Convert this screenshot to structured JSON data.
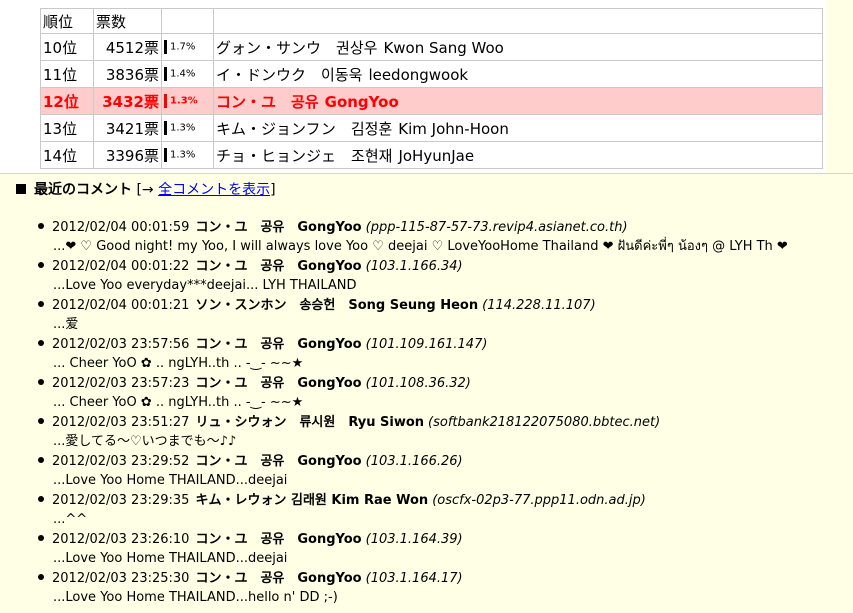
{
  "ranking": {
    "header": {
      "rank": "順位",
      "votes": "票数"
    },
    "rows": [
      {
        "rank": "10位",
        "votes": "4512票",
        "pct": "1.7%",
        "name_kana": "グォン・サンウ",
        "name_kr": "권상우",
        "name_en": "Kwon Sang Woo",
        "highlight": false
      },
      {
        "rank": "11位",
        "votes": "3836票",
        "pct": "1.4%",
        "name_kana": "イ・ドンウク",
        "name_kr": "이동욱",
        "name_en": "leedongwook",
        "highlight": false
      },
      {
        "rank": "12位",
        "votes": "3432票",
        "pct": "1.3%",
        "name_kana": "コン・ユ",
        "name_kr": "공유",
        "name_en": "GongYoo",
        "highlight": true
      },
      {
        "rank": "13位",
        "votes": "3421票",
        "pct": "1.3%",
        "name_kana": "キム・ジョンフン",
        "name_kr": "김정훈",
        "name_en": "Kim John-Hoon",
        "highlight": false
      },
      {
        "rank": "14位",
        "votes": "3396票",
        "pct": "1.3%",
        "name_kana": "チョ・ヒョンジェ",
        "name_kr": "조현재",
        "name_en": "JoHyunJae",
        "highlight": false
      }
    ]
  },
  "comments": {
    "title": "最近のコメント",
    "link_prefix": "[→",
    "link_label": "全コメントを表示",
    "link_suffix": "]",
    "items": [
      {
        "datetime": "2012/02/04 00:01:59",
        "who": "コン・ユ　공유　GongYoo",
        "host": "(ppp-115-87-57-73.revip4.asianet.co.th)",
        "text": "...❤ ♡ Good night! my Yoo, I will always love Yoo ♡ deejai ♡ LoveYooHome Thailand ❤ ฝันดีค่ะพี่ๆ น้องๆ @ LYH Th ❤"
      },
      {
        "datetime": "2012/02/04 00:01:22",
        "who": "コン・ユ　공유　GongYoo",
        "host": "(103.1.166.34)",
        "text": "...Love Yoo everyday***deejai... LYH THAILAND"
      },
      {
        "datetime": "2012/02/04 00:01:21",
        "who": "ソン・スンホン　송승헌　Song Seung Heon",
        "host": "(114.228.11.107)",
        "text": "...爱"
      },
      {
        "datetime": "2012/02/03 23:57:56",
        "who": "コン・ユ　공유　GongYoo",
        "host": "(101.109.161.147)",
        "text": "... Cheer YoO ✿ .. ngLYH..th .. ‐‿‐ ~~★"
      },
      {
        "datetime": "2012/02/03 23:57:23",
        "who": "コン・ユ　공유　GongYoo",
        "host": "(101.108.36.32)",
        "text": "... Cheer YoO ✿ .. ngLYH..th .. ‐‿‐ ~~★"
      },
      {
        "datetime": "2012/02/03 23:51:27",
        "who": "リュ・シウォン　류시원　Ryu Siwon",
        "host": "(softbank218122075080.bbtec.net)",
        "text": "...愛してる～♡いつまでも～♪♪"
      },
      {
        "datetime": "2012/02/03 23:29:52",
        "who": "コン・ユ　공유　GongYoo",
        "host": "(103.1.166.26)",
        "text": "...Love Yoo Home THAILAND...deejai"
      },
      {
        "datetime": "2012/02/03 23:29:35",
        "who": "キム・レウォン 김래원 Kim Rae Won",
        "host": "(oscfx-02p3-77.ppp11.odn.ad.jp)",
        "text": "...^^"
      },
      {
        "datetime": "2012/02/03 23:26:10",
        "who": "コン・ユ　공유　GongYoo",
        "host": "(103.1.164.39)",
        "text": "...Love Yoo Home THAILAND...deejai"
      },
      {
        "datetime": "2012/02/03 23:25:30",
        "who": "コン・ユ　공유　GongYoo",
        "host": "(103.1.164.17)",
        "text": "...Love Yoo Home THAILAND...hello n' DD ;-)"
      }
    ]
  }
}
